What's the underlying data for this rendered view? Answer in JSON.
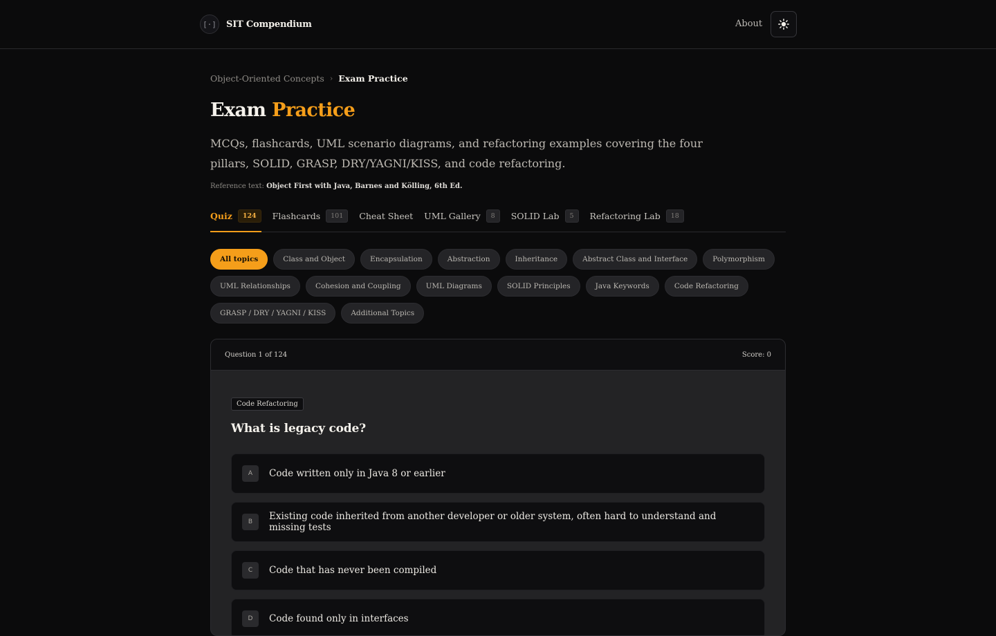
{
  "header": {
    "brand_logo": "[·]",
    "brand_name": "SIT Compendium",
    "about_label": "About",
    "theme_icon": "sun-icon"
  },
  "breadcrumb": {
    "parent": "Object-Oriented Concepts",
    "separator": "›",
    "current": "Exam Practice"
  },
  "page": {
    "title_part1": "Exam",
    "title_part2": "Practice",
    "description": "MCQs, flashcards, UML scenario diagrams, and refactoring examples covering the four pillars, SOLID, GRASP, DRY/YAGNI/KISS, and code refactoring.",
    "reference_label": "Reference text:",
    "reference_value": "Object First with Java, Barnes and Kölling, 6th Ed."
  },
  "tabs": [
    {
      "label": "Quiz",
      "count": "124",
      "active": true
    },
    {
      "label": "Flashcards",
      "count": "101",
      "active": false
    },
    {
      "label": "Cheat Sheet",
      "count": "",
      "active": false
    },
    {
      "label": "UML Gallery",
      "count": "8",
      "active": false
    },
    {
      "label": "SOLID Lab",
      "count": "5",
      "active": false
    },
    {
      "label": "Refactoring Lab",
      "count": "18",
      "active": false
    }
  ],
  "topics": [
    {
      "label": "All topics",
      "active": true
    },
    {
      "label": "Class and Object",
      "active": false
    },
    {
      "label": "Encapsulation",
      "active": false
    },
    {
      "label": "Abstraction",
      "active": false
    },
    {
      "label": "Inheritance",
      "active": false
    },
    {
      "label": "Abstract Class and Interface",
      "active": false
    },
    {
      "label": "Polymorphism",
      "active": false
    },
    {
      "label": "UML Relationships",
      "active": false
    },
    {
      "label": "Cohesion and Coupling",
      "active": false
    },
    {
      "label": "UML Diagrams",
      "active": false
    },
    {
      "label": "SOLID Principles",
      "active": false
    },
    {
      "label": "Java Keywords",
      "active": false
    },
    {
      "label": "Code Refactoring",
      "active": false
    },
    {
      "label": "GRASP / DRY / YAGNI / KISS",
      "active": false
    },
    {
      "label": "Additional Topics",
      "active": false
    }
  ],
  "quiz": {
    "progress": "Question 1 of 124",
    "score": "Score: 0",
    "topic_tag": "Code Refactoring",
    "question": "What is legacy code?",
    "options": [
      {
        "letter": "A",
        "text": "Code written only in Java 8 or earlier"
      },
      {
        "letter": "B",
        "text": "Existing code inherited from another developer or older system, often hard to understand and missing tests"
      },
      {
        "letter": "C",
        "text": "Code that has never been compiled"
      },
      {
        "letter": "D",
        "text": "Code found only in interfaces"
      }
    ]
  },
  "colors": {
    "accent": "#f59e1a",
    "background": "#0b0b0c",
    "card": "#232325"
  }
}
